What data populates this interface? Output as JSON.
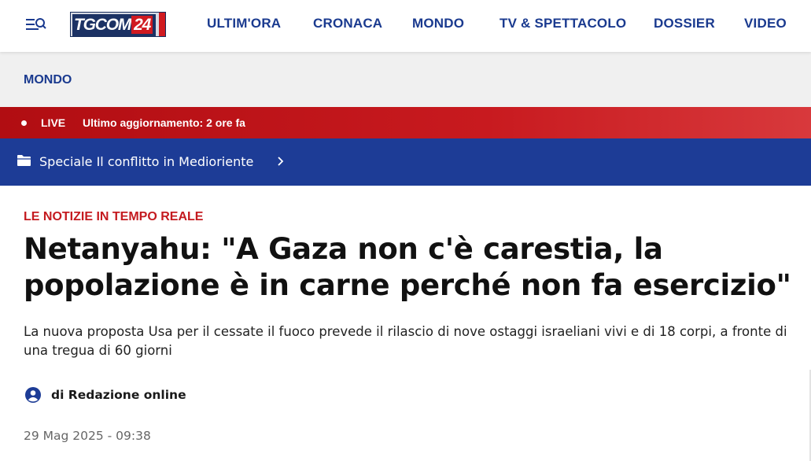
{
  "header": {
    "logo": {
      "text": "TGCOM",
      "number": "24"
    },
    "nav": [
      "ULTIM'ORA",
      "CRONACA",
      "MONDO",
      "TV & SPETTACOLO",
      "DOSSIER",
      "VIDEO"
    ]
  },
  "section": {
    "label": "MONDO"
  },
  "live": {
    "label": "LIVE",
    "update": "Ultimo aggiornamento: 2 ore fa"
  },
  "special": {
    "label": "Speciale Il conflitto in Medioriente"
  },
  "article": {
    "kicker": "LE NOTIZIE IN TEMPO REALE",
    "title": "Netanyahu: \"A Gaza non c'è carestia, la popolazione è in carne perché non fa esercizio\"",
    "subtitle": "La nuova proposta Usa per il cessate il fuoco prevede il rilascio di nove ostaggi israeliani vivi e di 18 corpi, a fronte di una tregua di 60 giorni",
    "author": "di Redazione online",
    "date": "29 Mag 2025 - 09:38"
  },
  "colors": {
    "brand_blue": "#1d3c96",
    "nav_blue": "#1a3a8f",
    "live_red": "#c41a1f"
  },
  "icons": {
    "menu": "menu-search-icon",
    "folder": "folder-icon",
    "chevron": "chevron-right-icon",
    "user": "user-circle-icon"
  }
}
